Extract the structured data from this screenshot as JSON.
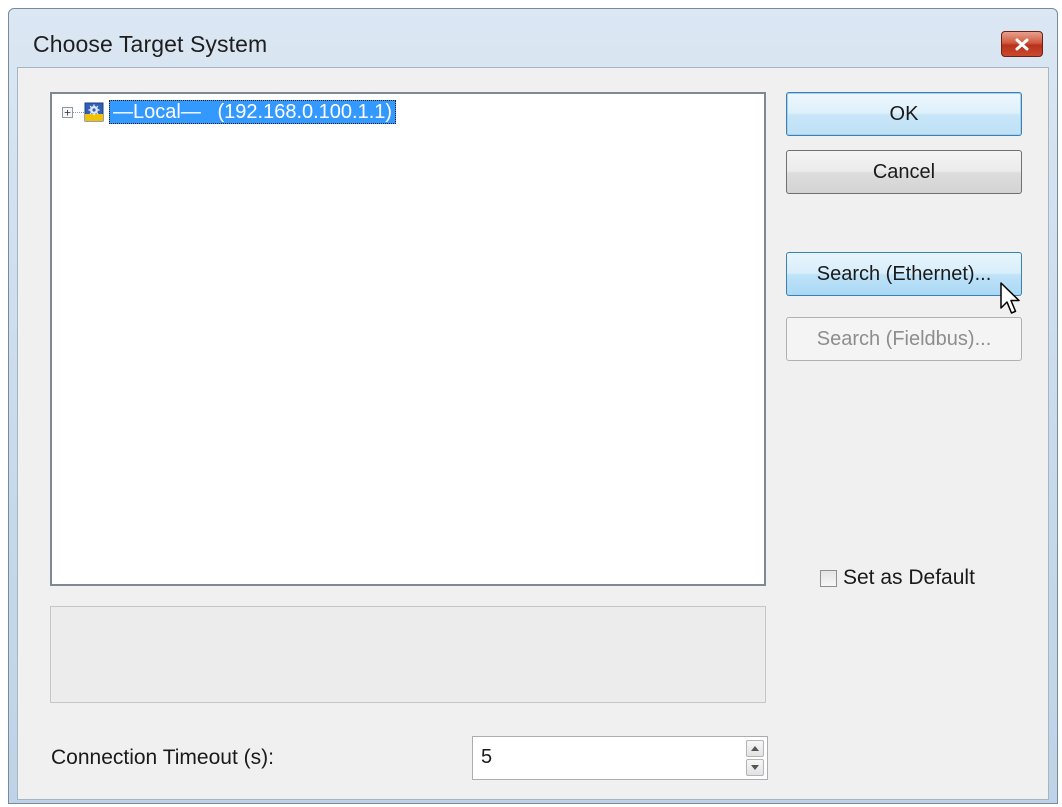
{
  "window": {
    "title": "Choose Target System",
    "close_icon": "close-icon"
  },
  "tree": {
    "nodes": [
      {
        "expander": "+",
        "icon": "target-system-icon",
        "label": "—Local—   (192.168.0.100.1.1)",
        "selected": true
      }
    ]
  },
  "buttons": {
    "ok": "OK",
    "cancel": "Cancel",
    "search_ethernet": "Search (Ethernet)...",
    "search_fieldbus": "Search (Fieldbus)..."
  },
  "set_as_default": {
    "label": "Set as Default",
    "checked": false
  },
  "connection_timeout": {
    "label": "Connection Timeout (s):",
    "value": "5"
  },
  "colors": {
    "selection": "#3399ff",
    "close_button": "#c9492e",
    "focused_border": "#3c7fb1"
  }
}
